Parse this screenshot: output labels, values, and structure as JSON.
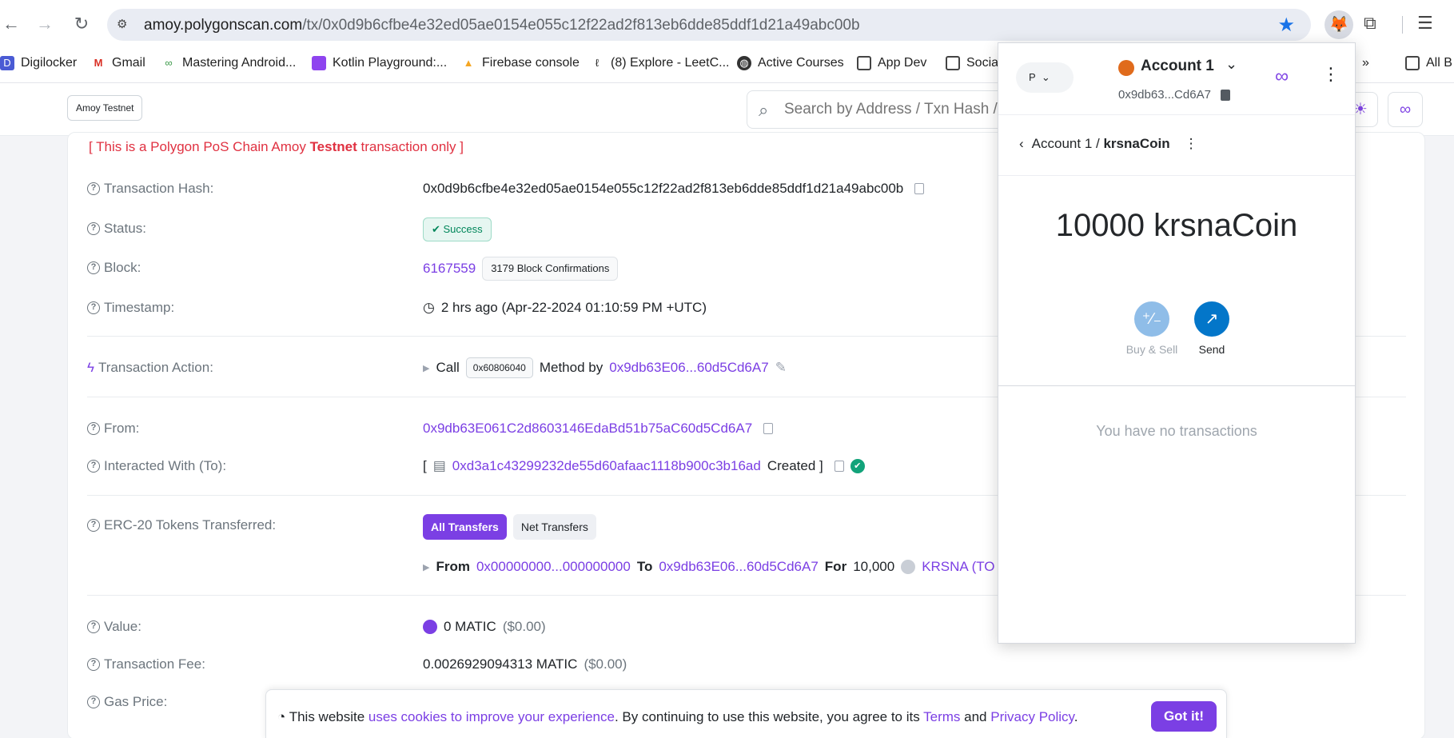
{
  "browser": {
    "url_host": "amoy.polygonscan.com",
    "url_path": "/tx/0x0d9b6cfbe4e32ed05ae0154e055c12f22ad2f813eb6dde85ddf1d21a49abc00b",
    "bookmarks": [
      {
        "label": "Digilocker",
        "icon": "digilocker-icon"
      },
      {
        "label": "Gmail",
        "icon": "gmail-icon"
      },
      {
        "label": "Mastering Android...",
        "icon": "android-icon"
      },
      {
        "label": "Kotlin Playground:...",
        "icon": "kotlin-icon"
      },
      {
        "label": "Firebase console",
        "icon": "firebase-icon"
      },
      {
        "label": "(8) Explore - LeetC...",
        "icon": "leetcode-icon"
      },
      {
        "label": "Active Courses",
        "icon": "globe-icon"
      },
      {
        "label": "App Dev",
        "icon": "folder-icon"
      },
      {
        "label": "Socia",
        "icon": "folder-icon"
      },
      {
        "label": "All B",
        "icon": "folder-icon"
      }
    ]
  },
  "header": {
    "network_badge": "Amoy Testnet",
    "search_placeholder": "Search by Address / Txn Hash /"
  },
  "tx": {
    "testnet_note_pre": "[ This is a Polygon PoS Chain Amoy ",
    "testnet_note_bold": "Testnet",
    "testnet_note_post": " transaction only ]",
    "hash_label": "Transaction Hash:",
    "hash": "0x0d9b6cfbe4e32ed05ae0154e055c12f22ad2f813eb6dde85ddf1d21a49abc00b",
    "status_label": "Status:",
    "status": "Success",
    "block_label": "Block:",
    "block": "6167559",
    "confirmations": "3179 Block Confirmations",
    "timestamp_label": "Timestamp:",
    "timestamp": "2 hrs ago (Apr-22-2024 01:10:59 PM +UTC)",
    "action_label": "Transaction Action:",
    "action_call": "Call",
    "action_method": "0x60806040",
    "action_method_by": "Method by",
    "action_address": "0x9db63E06...60d5Cd6A7",
    "from_label": "From:",
    "from": "0x9db63E061C2d8603146EdaBd51b75aC60d5Cd6A7",
    "to_label": "Interacted With (To):",
    "to_open": "[",
    "to_address": "0xd3a1c43299232de55d60afaac1118b900c3b16ad",
    "to_created": "Created ]",
    "erc20_label": "ERC-20 Tokens Transferred:",
    "erc20_tab_all": "All Transfers",
    "erc20_tab_net": "Net Transfers",
    "transfer_from_word": "From",
    "transfer_from": "0x00000000...000000000",
    "transfer_to_word": "To",
    "transfer_to": "0x9db63E06...60d5Cd6A7",
    "transfer_for_word": "For",
    "transfer_amount": "10,000",
    "transfer_token": "KRSNA",
    "transfer_token_suffix": "(TO",
    "value_label": "Value:",
    "value": "0 MATIC",
    "value_usd": "($0.00)",
    "fee_label": "Transaction Fee:",
    "fee": "0.0026929094313 MATIC",
    "fee_usd": "($0.00)",
    "gas_label": "Gas Price:"
  },
  "cookie": {
    "pre": "This website ",
    "link1": "uses cookies to improve your experience",
    "mid": ". By continuing to use this website, you agree to its ",
    "link2": "Terms",
    "and": " and ",
    "link3": "Privacy Policy",
    "end": ".",
    "button": "Got it!"
  },
  "metamask": {
    "network_letter": "P",
    "account_name": "Account 1",
    "account_address": "0x9db63...Cd6A7",
    "crumb_account": "Account 1 /",
    "crumb_token": "krsnaCoin",
    "balance": "10000 krsnaCoin",
    "buy_sell": "Buy & Sell",
    "send": "Send",
    "empty": "You have no transactions"
  },
  "colors": {
    "accent": "#7b3fe4",
    "testnet_red": "#e03141",
    "success_green": "#00865a",
    "metamask_blue": "#0376c9"
  }
}
